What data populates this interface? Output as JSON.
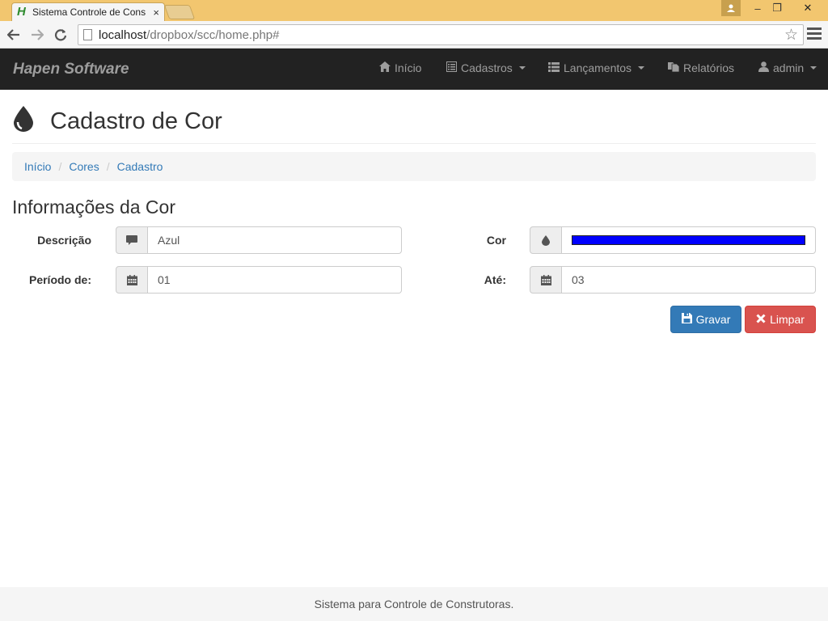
{
  "browser": {
    "tab_title": "Sistema Controle de Cons",
    "favicon_letter": "H",
    "tab_close": "×",
    "url_host": "localhost",
    "url_path": "/dropbox/scc/home.php#",
    "window_min": "–",
    "window_max": "❐",
    "window_close": "✕"
  },
  "navbar": {
    "brand": "Hapen Software",
    "items": [
      {
        "label": "Início",
        "icon": "home-icon"
      },
      {
        "label": "Cadastros",
        "icon": "list-alt-icon"
      },
      {
        "label": "Lançamentos",
        "icon": "th-list-icon"
      },
      {
        "label": "Relatórios",
        "icon": "documents-icon"
      },
      {
        "label": "admin",
        "icon": "user-icon"
      }
    ]
  },
  "page": {
    "title": "Cadastro de Cor",
    "title_icon": "tint-icon"
  },
  "breadcrumb": {
    "items": [
      "Início",
      "Cores",
      "Cadastro"
    ],
    "separator": "/"
  },
  "form": {
    "section_title": "Informações da Cor",
    "descricao": {
      "label": "Descrição",
      "value": "Azul",
      "icon": "comment-icon"
    },
    "cor": {
      "label": "Cor",
      "value_color": "#0000ff",
      "icon": "tint-icon"
    },
    "periodo_de": {
      "label": "Período de:",
      "value": "01",
      "icon": "calendar-icon"
    },
    "ate": {
      "label": "Até:",
      "value": "03",
      "icon": "calendar-icon"
    }
  },
  "actions": {
    "save_label": "Gravar",
    "clear_label": "Limpar"
  },
  "footer": {
    "text": "Sistema para Controle de Construtoras."
  },
  "colors": {
    "navbar_bg": "#222222",
    "primary": "#337ab7",
    "danger": "#d9534f",
    "tab_bar": "#f2c66f"
  }
}
